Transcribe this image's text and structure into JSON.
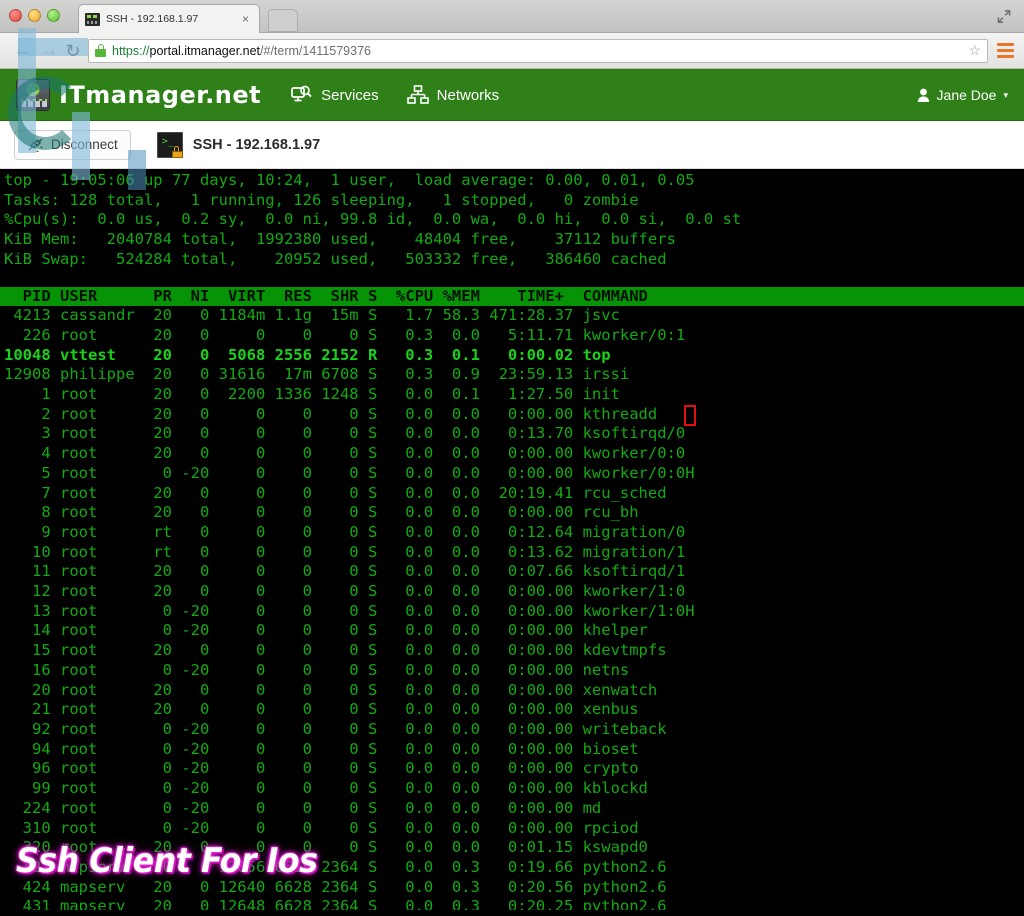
{
  "browser": {
    "tab_title": "SSH - 192.168.1.97",
    "tab_close_label": "×",
    "back_label": "←",
    "forward_label": "→",
    "reload_label": "↻",
    "url_scheme": "https://",
    "url_host": "portal.itmanager.net",
    "url_path": "/#/term/1411579376",
    "bookmark_label": "☆"
  },
  "navbar": {
    "brand": "ITmanager.net",
    "links": [
      {
        "label": "Services",
        "icon": "monitor-search-icon"
      },
      {
        "label": "Networks",
        "icon": "network-hierarchy-icon"
      }
    ],
    "user": "Jane Doe",
    "caret": "▾",
    "accent_color": "#2f8018"
  },
  "toolbar": {
    "disconnect_label": "Disconnect",
    "session_title": "SSH - 192.168.1.97",
    "terminal_prompt_glyph": ">_"
  },
  "terminal": {
    "fg_color": "#13a913",
    "bg_color": "#000000",
    "header_bg": "#069406",
    "cursor_color": "#e01010",
    "summary": [
      "top - 19:05:06 up 77 days, 10:24,  1 user,  load average: 0.00, 0.01, 0.05",
      "Tasks: 128 total,   1 running, 126 sleeping,   1 stopped,   0 zombie",
      "%Cpu(s):  0.0 us,  0.2 sy,  0.0 ni, 99.8 id,  0.0 wa,  0.0 hi,  0.0 si,  0.0 st",
      "KiB Mem:   2040784 total,  1992380 used,    48404 free,    37112 buffers",
      "KiB Swap:   524284 total,    20952 used,   503332 free,   386460 cached"
    ],
    "header_row": "  PID USER      PR  NI  VIRT  RES  SHR S  %CPU %MEM    TIME+  COMMAND                                                    ",
    "rows": [
      {
        "text": " 4213 cassandr  20   0 1184m 1.1g  15m S   1.7 58.3 471:28.37 jsvc",
        "bold": false
      },
      {
        "text": "  226 root      20   0     0    0    0 S   0.3  0.0   5:11.71 kworker/0:1",
        "bold": false
      },
      {
        "text": "10048 vttest    20   0  5068 2556 2152 R   0.3  0.1   0:00.02 top",
        "bold": true
      },
      {
        "text": "12908 philippe  20   0 31616  17m 6708 S   0.3  0.9  23:59.13 irssi",
        "bold": false
      },
      {
        "text": "    1 root      20   0  2200 1336 1248 S   0.0  0.1   1:27.50 init",
        "bold": false
      },
      {
        "text": "    2 root      20   0     0    0    0 S   0.0  0.0   0:00.00 kthreadd",
        "bold": false
      },
      {
        "text": "    3 root      20   0     0    0    0 S   0.0  0.0   0:13.70 ksoftirqd/0",
        "bold": false
      },
      {
        "text": "    4 root      20   0     0    0    0 S   0.0  0.0   0:00.00 kworker/0:0",
        "bold": false
      },
      {
        "text": "    5 root       0 -20     0    0    0 S   0.0  0.0   0:00.00 kworker/0:0H",
        "bold": false
      },
      {
        "text": "    7 root      20   0     0    0    0 S   0.0  0.0  20:19.41 rcu_sched",
        "bold": false
      },
      {
        "text": "    8 root      20   0     0    0    0 S   0.0  0.0   0:00.00 rcu_bh",
        "bold": false
      },
      {
        "text": "    9 root      rt   0     0    0    0 S   0.0  0.0   0:12.64 migration/0",
        "bold": false
      },
      {
        "text": "   10 root      rt   0     0    0    0 S   0.0  0.0   0:13.62 migration/1",
        "bold": false
      },
      {
        "text": "   11 root      20   0     0    0    0 S   0.0  0.0   0:07.66 ksoftirqd/1",
        "bold": false
      },
      {
        "text": "   12 root      20   0     0    0    0 S   0.0  0.0   0:00.00 kworker/1:0",
        "bold": false
      },
      {
        "text": "   13 root       0 -20     0    0    0 S   0.0  0.0   0:00.00 kworker/1:0H",
        "bold": false
      },
      {
        "text": "   14 root       0 -20     0    0    0 S   0.0  0.0   0:00.00 khelper",
        "bold": false
      },
      {
        "text": "   15 root      20   0     0    0    0 S   0.0  0.0   0:00.00 kdevtmpfs",
        "bold": false
      },
      {
        "text": "   16 root       0 -20     0    0    0 S   0.0  0.0   0:00.00 netns",
        "bold": false
      },
      {
        "text": "   20 root      20   0     0    0    0 S   0.0  0.0   0:00.00 xenwatch",
        "bold": false
      },
      {
        "text": "   21 root      20   0     0    0    0 S   0.0  0.0   0:00.00 xenbus",
        "bold": false
      },
      {
        "text": "   92 root       0 -20     0    0    0 S   0.0  0.0   0:00.00 writeback",
        "bold": false
      },
      {
        "text": "   94 root       0 -20     0    0    0 S   0.0  0.0   0:00.00 bioset",
        "bold": false
      },
      {
        "text": "   96 root       0 -20     0    0    0 S   0.0  0.0   0:00.00 crypto",
        "bold": false
      },
      {
        "text": "   99 root       0 -20     0    0    0 S   0.0  0.0   0:00.00 kblockd",
        "bold": false
      },
      {
        "text": "  224 root       0 -20     0    0    0 S   0.0  0.0   0:00.00 md",
        "bold": false
      },
      {
        "text": "  310 root       0 -20     0    0    0 S   0.0  0.0   0:00.00 rpciod",
        "bold": false
      },
      {
        "text": "  320 root      20   0     0    0    0 S   0.0  0.0   0:01.15 kswapd0",
        "bold": false
      },
      {
        "text": "  422 mapserv   20   0 12656 6616 2364 S   0.0  0.3   0:19.66 python2.6",
        "bold": false
      },
      {
        "text": "  424 mapserv   20   0 12640 6628 2364 S   0.0  0.3   0:20.56 python2.6",
        "bold": false
      },
      {
        "text": "  431 mapserv   20   0 12648 6628 2364 S   0.0  0.3   0:20.25 python2.6",
        "bold": false
      }
    ]
  },
  "watermark": {
    "text": "Ssh Client For Ios"
  }
}
